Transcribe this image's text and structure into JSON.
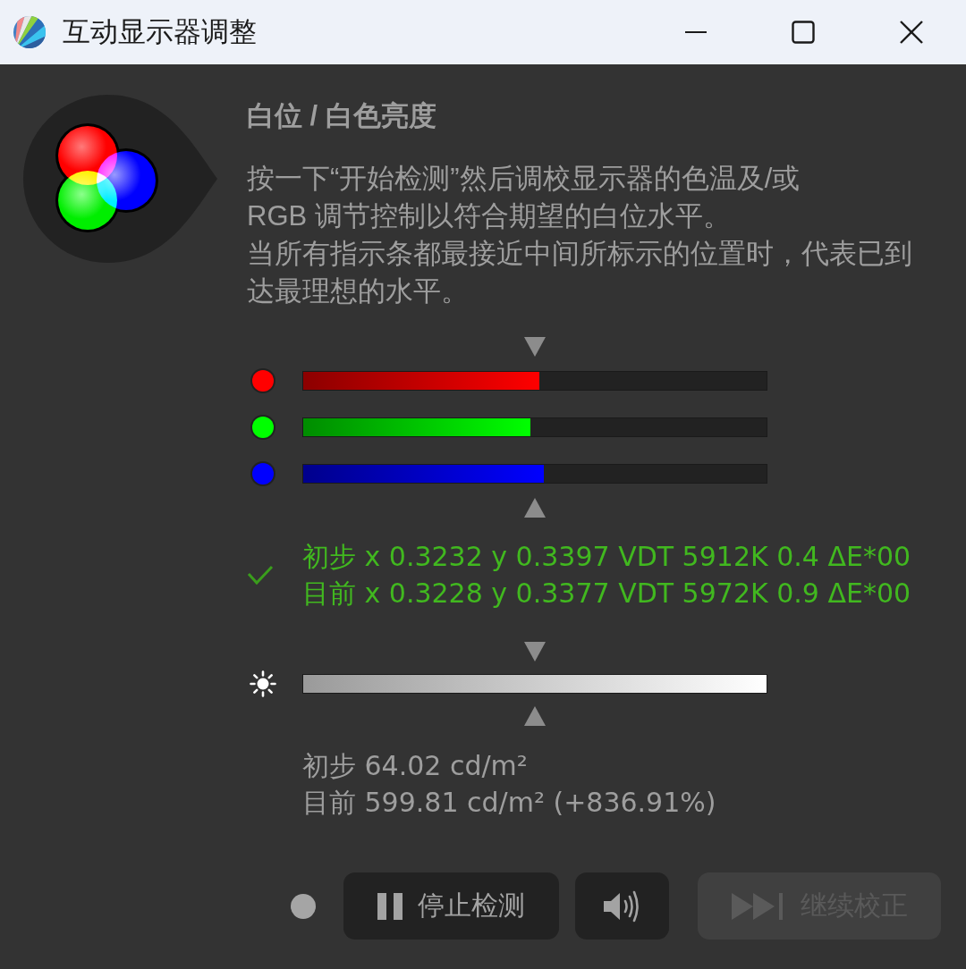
{
  "window": {
    "title": "互动显示器调整"
  },
  "heading": "白位 / 白色亮度",
  "description": [
    "按一下“开始检测”然后调校显示器的色温及/或\nRGB 调节控制以符合期望的白位水平。",
    "当所有指示条都最接近中间所标示的位置时，代表已到达最理想的水平。"
  ],
  "channels": [
    {
      "color": "#ff0000",
      "level": 0.51
    },
    {
      "color": "#00ff00",
      "level": 0.49
    },
    {
      "color": "#0000ff",
      "level": 0.52
    }
  ],
  "result": {
    "passed": true,
    "lines": [
      "初步 x 0.3232 y 0.3397 VDT 5912K 0.4 ΔE*00",
      "目前 x 0.3228 y 0.3377 VDT 5972K 0.9 ΔE*00"
    ]
  },
  "luminance": {
    "level": 1,
    "lines": [
      "初步 64.02 cd/m²",
      "目前 599.81 cd/m² (+836.91%)"
    ]
  },
  "buttons": [
    {
      "kind": "pause",
      "label": "停止检测",
      "disabled": false
    },
    {
      "kind": "sound",
      "disabled": false
    },
    {
      "kind": "skip",
      "label": "继续校正",
      "disabled": true
    }
  ]
}
